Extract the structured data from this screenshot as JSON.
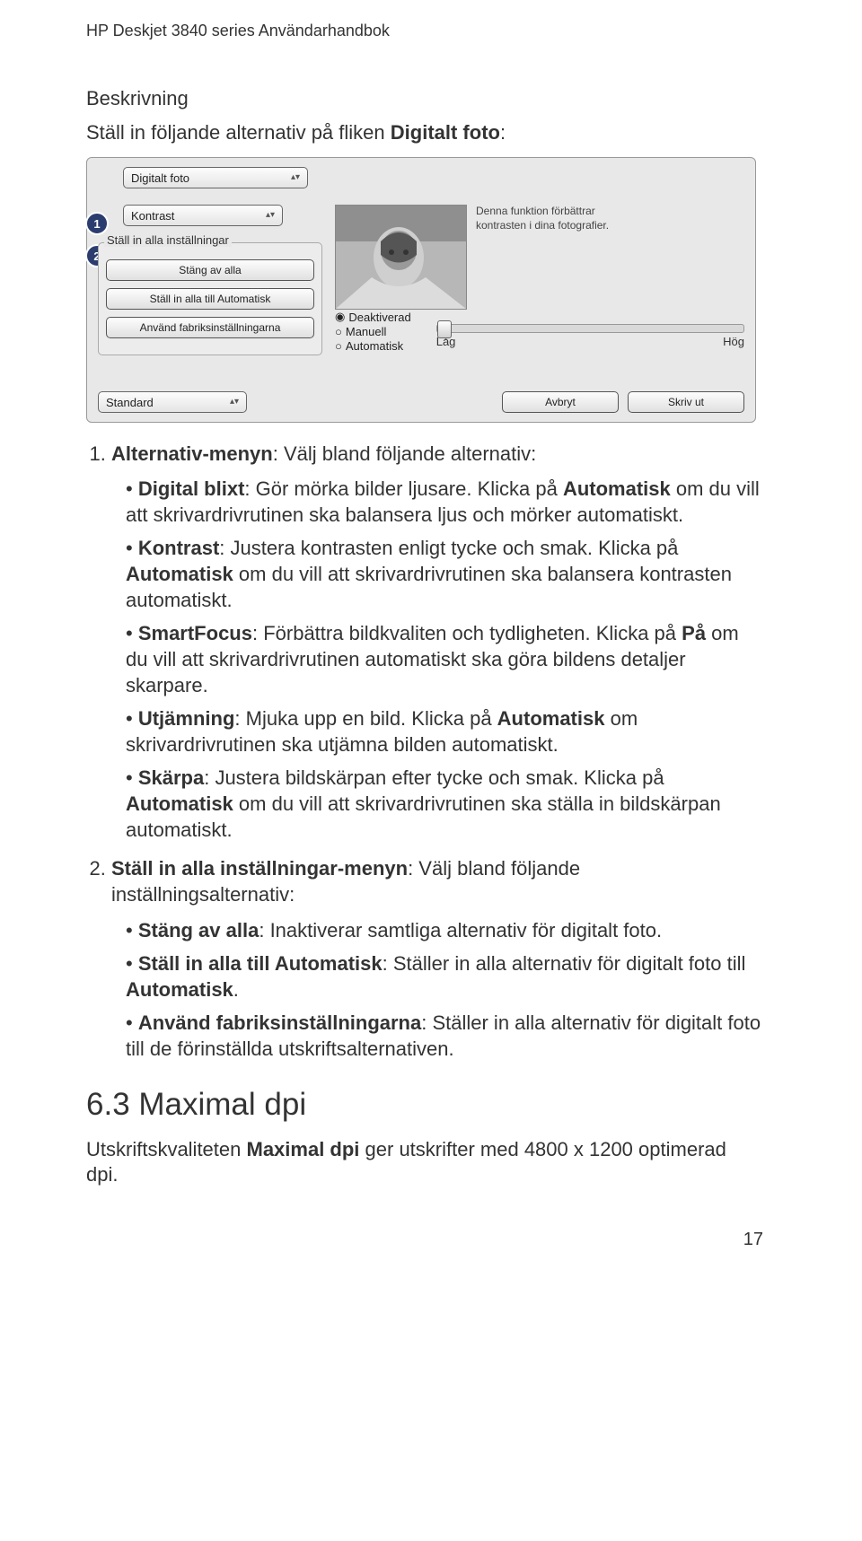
{
  "header": "HP Deskjet 3840 series Användarhandbok",
  "section_minor": "Beskrivning",
  "intro": {
    "pre": "Ställ in följande alternativ på fliken ",
    "bold": "Digitalt foto",
    "post": ":"
  },
  "dialog": {
    "topCombo": "Digitalt foto",
    "badge1": "1",
    "badge2": "2",
    "kontrastCombo": "Kontrast",
    "groupLegend": "Ställ in alla inställningar",
    "btn_off": "Stäng av alla",
    "btn_auto": "Ställ in alla till Automatisk",
    "btn_factory": "Använd fabriksinställningarna",
    "caption_l1": "Denna funktion förbättrar",
    "caption_l2": "kontrasten i dina fotografier.",
    "radio_deak": "Deaktiverad",
    "radio_man": "Manuell",
    "radio_auto": "Automatisk",
    "slider_low": "Låg",
    "slider_high": "Hög",
    "bottom_combo": "Standard",
    "btn_cancel": "Avbryt",
    "btn_print": "Skriv ut"
  },
  "list1": {
    "prefix": "Alternativ-menyn",
    "suffix": ": Välj bland följande alternativ:",
    "bullets": [
      {
        "b": "Digital blixt",
        "t": ": Gör mörka bilder ljusare. Klicka på ",
        "b2": "Automatisk",
        "t2": " om du vill att skrivardrivrutinen ska balansera ljus och mörker automatiskt."
      },
      {
        "b": "Kontrast",
        "t": ": Justera kontrasten enligt tycke och smak. Klicka på ",
        "b2": "Automatisk",
        "t2": " om du vill att skrivardrivrutinen ska balansera kontrasten automatiskt."
      },
      {
        "b": "SmartFocus",
        "t": ": Förbättra bildkvaliten och tydligheten. Klicka på ",
        "b2": "På",
        "t2": " om du vill att skrivardrivrutinen automatiskt ska göra bildens detaljer skarpare."
      },
      {
        "b": "Utjämning",
        "t": ": Mjuka upp en bild. Klicka på ",
        "b2": "Automatisk",
        "t2": " om skrivardrivrutinen ska utjämna bilden automatiskt."
      },
      {
        "b": "Skärpa",
        "t": ": Justera bildskärpan efter tycke och smak. Klicka på ",
        "b2": "Automatisk",
        "t2": " om du vill att skrivardrivrutinen ska ställa in bildskärpan automatiskt."
      }
    ]
  },
  "list2": {
    "prefix": "Ställ in alla inställningar-menyn",
    "suffix": ": Välj bland följande inställningsalternativ:",
    "bullets": [
      {
        "b": "Stäng av alla",
        "t": ": Inaktiverar samtliga alternativ för digitalt foto."
      },
      {
        "b": "Ställ in alla till Automatisk",
        "t": ": Ställer in alla alternativ för digitalt foto till ",
        "b2": "Automatisk",
        "t2": "."
      },
      {
        "b": "Använd fabriksinställningarna",
        "t": ": Ställer in alla alternativ för digitalt foto till de förinställda utskriftsalternativen."
      }
    ]
  },
  "h2": "6.3 Maximal dpi",
  "para": {
    "pre": "Utskriftskvaliteten ",
    "b": "Maximal dpi",
    "post": " ger utskrifter med 4800 x 1200 optimerad dpi."
  },
  "pageNumber": "17"
}
